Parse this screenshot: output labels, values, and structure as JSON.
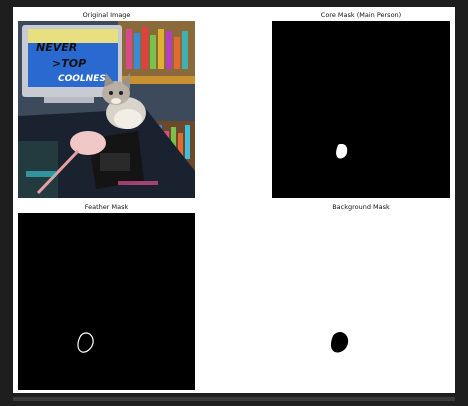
{
  "figure": {
    "panels": [
      {
        "title": "Original Image"
      },
      {
        "title": "Core Mask (Main Person)"
      },
      {
        "title": "Feather Mask"
      },
      {
        "title": "Background Mask"
      }
    ]
  },
  "photo_text": {
    "line1": "NEVER",
    "line2": ">TOP",
    "line3": "COOLNES"
  },
  "colors": {
    "page_bg": "#1e1e1e",
    "figure_bg": "#ffffff",
    "mask_black": "#000000",
    "mask_white": "#ffffff"
  }
}
